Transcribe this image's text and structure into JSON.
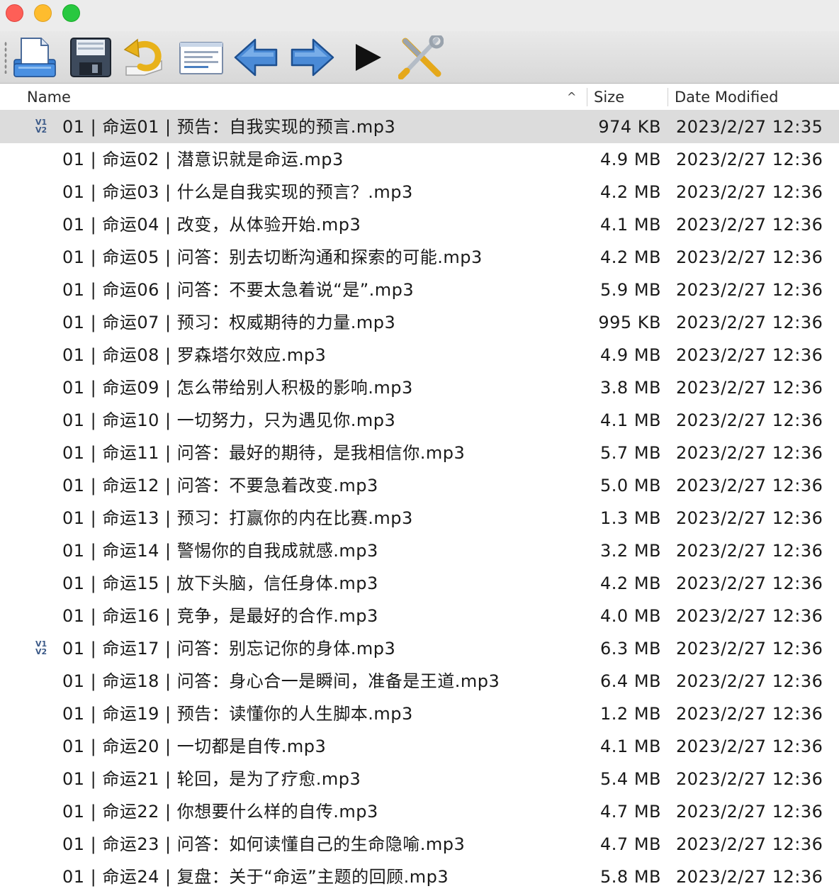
{
  "window": {
    "controls": [
      "close",
      "minimize",
      "zoom"
    ]
  },
  "toolbar": {
    "buttons": [
      {
        "name": "new",
        "icon": "new-document-icon"
      },
      {
        "name": "save",
        "icon": "floppy-disk-icon"
      },
      {
        "name": "undo",
        "icon": "undo-arrow-icon"
      },
      {
        "name": "info",
        "icon": "tag-window-icon"
      },
      {
        "name": "previous",
        "icon": "left-arrow-icon"
      },
      {
        "name": "next",
        "icon": "right-arrow-icon"
      },
      {
        "name": "play",
        "icon": "play-icon"
      },
      {
        "name": "tools",
        "icon": "tools-icon"
      }
    ]
  },
  "columns": {
    "name": "Name",
    "size": "Size",
    "date": "Date Modified",
    "sort_indicator": "^"
  },
  "files": [
    {
      "name": "01 | 命运01 | 预告：自我实现的预言.mp3",
      "size": "974 KB",
      "date": "2023/2/27 12:35",
      "badge": true,
      "selected": true
    },
    {
      "name": "01 | 命运02 | 潜意识就是命运.mp3",
      "size": "4.9 MB",
      "date": "2023/2/27 12:36",
      "badge": false,
      "selected": false
    },
    {
      "name": "01 | 命运03 | 什么是自我实现的预言？.mp3",
      "size": "4.2 MB",
      "date": "2023/2/27 12:36",
      "badge": false,
      "selected": false
    },
    {
      "name": "01 | 命运04 | 改变，从体验开始.mp3",
      "size": "4.1 MB",
      "date": "2023/2/27 12:36",
      "badge": false,
      "selected": false
    },
    {
      "name": "01 | 命运05 | 问答：别去切断沟通和探索的可能.mp3",
      "size": "4.2 MB",
      "date": "2023/2/27 12:36",
      "badge": false,
      "selected": false
    },
    {
      "name": "01 | 命运06 | 问答：不要太急着说“是”.mp3",
      "size": "5.9 MB",
      "date": "2023/2/27 12:36",
      "badge": false,
      "selected": false
    },
    {
      "name": "01 | 命运07 | 预习：权威期待的力量.mp3",
      "size": "995 KB",
      "date": "2023/2/27 12:36",
      "badge": false,
      "selected": false
    },
    {
      "name": "01 | 命运08 | 罗森塔尔效应.mp3",
      "size": "4.9 MB",
      "date": "2023/2/27 12:36",
      "badge": false,
      "selected": false
    },
    {
      "name": "01 | 命运09 | 怎么带给别人积极的影响.mp3",
      "size": "3.8 MB",
      "date": "2023/2/27 12:36",
      "badge": false,
      "selected": false
    },
    {
      "name": "01 | 命运10 | 一切努力，只为遇见你.mp3",
      "size": "4.1 MB",
      "date": "2023/2/27 12:36",
      "badge": false,
      "selected": false
    },
    {
      "name": "01 | 命运11 | 问答：最好的期待，是我相信你.mp3",
      "size": "5.7 MB",
      "date": "2023/2/27 12:36",
      "badge": false,
      "selected": false
    },
    {
      "name": "01 | 命运12 | 问答：不要急着改变.mp3",
      "size": "5.0 MB",
      "date": "2023/2/27 12:36",
      "badge": false,
      "selected": false
    },
    {
      "name": "01 | 命运13 | 预习：打赢你的内在比赛.mp3",
      "size": "1.3 MB",
      "date": "2023/2/27 12:36",
      "badge": false,
      "selected": false
    },
    {
      "name": "01 | 命运14 | 警惕你的自我成就感.mp3",
      "size": "3.2 MB",
      "date": "2023/2/27 12:36",
      "badge": false,
      "selected": false
    },
    {
      "name": "01 | 命运15 | 放下头脑，信任身体.mp3",
      "size": "4.2 MB",
      "date": "2023/2/27 12:36",
      "badge": false,
      "selected": false
    },
    {
      "name": "01 | 命运16 | 竞争，是最好的合作.mp3",
      "size": "4.0 MB",
      "date": "2023/2/27 12:36",
      "badge": false,
      "selected": false
    },
    {
      "name": "01 | 命运17 | 问答：别忘记你的身体.mp3",
      "size": "6.3 MB",
      "date": "2023/2/27 12:36",
      "badge": true,
      "selected": false
    },
    {
      "name": "01 | 命运18 | 问答：身心合一是瞬间，准备是王道.mp3",
      "size": "6.4 MB",
      "date": "2023/2/27 12:36",
      "badge": false,
      "selected": false
    },
    {
      "name": "01 | 命运19 | 预告：读懂你的人生脚本.mp3",
      "size": "1.2 MB",
      "date": "2023/2/27 12:36",
      "badge": false,
      "selected": false
    },
    {
      "name": "01 | 命运20 |  一切都是自传.mp3",
      "size": "4.1 MB",
      "date": "2023/2/27 12:36",
      "badge": false,
      "selected": false
    },
    {
      "name": "01 | 命运21 | 轮回，是为了疗愈.mp3",
      "size": "5.4 MB",
      "date": "2023/2/27 12:36",
      "badge": false,
      "selected": false
    },
    {
      "name": "01 | 命运22 | 你想要什么样的自传.mp3",
      "size": "4.7 MB",
      "date": "2023/2/27 12:36",
      "badge": false,
      "selected": false
    },
    {
      "name": "01 | 命运23 | 问答：如何读懂自己的生命隐喻.mp3",
      "size": "4.7 MB",
      "date": "2023/2/27 12:36",
      "badge": false,
      "selected": false
    },
    {
      "name": "01 | 命运24 | 复盘：关于“命运”主题的回顾.mp3",
      "size": "5.8 MB",
      "date": "2023/2/27 12:36",
      "badge": false,
      "selected": false
    }
  ],
  "badge_text": {
    "top": "V1",
    "bottom": "V2"
  },
  "colors": {
    "selected_row": "#dcdcdc",
    "toolbar_top": "#e9e9e9",
    "toolbar_bottom": "#d8d8d8"
  }
}
